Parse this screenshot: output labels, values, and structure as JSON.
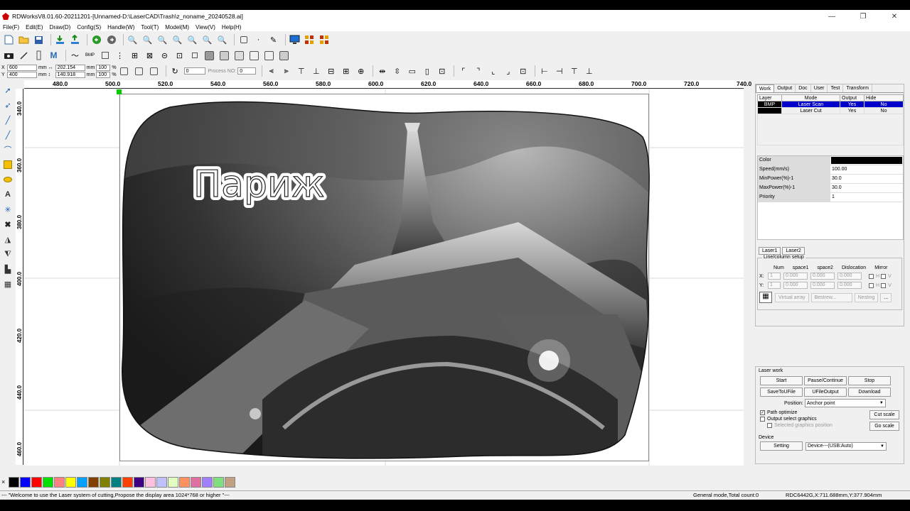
{
  "window": {
    "title": "RDWorksV8.01.60-20211201-[Unnamed-D:\\LaserCAD\\Trash\\z_noname_20240528.ai]",
    "controls": [
      "—",
      "❐",
      "✕"
    ]
  },
  "menu": [
    "File(F)",
    "Edit(E)",
    "Draw(D)",
    "Config(S)",
    "Handle(W)",
    "Tool(T)",
    "Model(M)",
    "View(V)",
    "Help(H)"
  ],
  "coords": {
    "x_label": "X",
    "x_value": "600",
    "y_label": "Y",
    "y_value": "400",
    "unit": "mm",
    "w_value": "202.154",
    "h_value": "140.918",
    "w_pct": "100",
    "h_pct": "100",
    "pct": "%",
    "rotate_value": "0",
    "process_no_label": "Process NO:",
    "process_no_value": "0"
  },
  "ruler": {
    "h": [
      "480.0",
      "500.0",
      "520.0",
      "540.0",
      "560.0",
      "580.0",
      "600.0",
      "620.0",
      "640.0",
      "660.0",
      "680.0",
      "700.0",
      "720.0",
      "740.0"
    ],
    "v": [
      "340.0",
      "360.0",
      "380.0",
      "400.0",
      "420.0",
      "440.0",
      "460.0"
    ]
  },
  "canvas": {
    "overlay_text": "Париж"
  },
  "panel": {
    "tabs": [
      "Work",
      "Output",
      "Doc",
      "User",
      "Test",
      "Transform"
    ],
    "layer_headers": [
      "Layer",
      "Mode",
      "Output",
      "Hide"
    ],
    "layers": [
      {
        "layer": "BMP",
        "mode": "Laser Scan",
        "output": "Yes",
        "hide": "No"
      },
      {
        "layer": "",
        "mode": "Laser Cut",
        "output": "Yes",
        "hide": "No"
      }
    ],
    "props": [
      {
        "k": "Color",
        "v": ""
      },
      {
        "k": "Speed(mm/s)",
        "v": "100.00"
      },
      {
        "k": "MinPower(%)-1",
        "v": "30.0"
      },
      {
        "k": "MaxPower(%)-1",
        "v": "30.0"
      },
      {
        "k": "Priority",
        "v": "1"
      }
    ],
    "laser_tabs": [
      "Laser1",
      "Laser2"
    ],
    "linecol": {
      "title": "Line/column setup",
      "headers": [
        "Num",
        "space1",
        "space2",
        "Dislocation",
        "Mirror"
      ],
      "x_label": "X:",
      "y_label": "Y:",
      "x_vals": [
        "1",
        "0.000",
        "0.000",
        "0.000"
      ],
      "y_vals": [
        "1",
        "0.000",
        "0.000",
        "0.000"
      ],
      "mirror_h": "H",
      "mirror_v": "V",
      "buttons": [
        "Virtual array",
        "Bestrew...",
        "Nesting",
        "..."
      ]
    }
  },
  "laser_work": {
    "title": "Laser work",
    "btns1": [
      "Start",
      "Pause/Continue",
      "Stop"
    ],
    "btns2": [
      "SaveToUFile",
      "UFileOutput",
      "Download"
    ],
    "position_label": "Position:",
    "position_value": "Anchor point",
    "path_optimize": "Path optimize",
    "output_select": "Output select graphics",
    "selected_pos": "Selected graphics position",
    "cut_scale": "Cut scale",
    "go_scale": "Go scale",
    "device_title": "Device",
    "setting": "Setting",
    "device_value": "Device---(USB:Auto)"
  },
  "palette": [
    "#000000",
    "#0000ff",
    "#ff0000",
    "#00e000",
    "#ff8080",
    "#ffff00",
    "#00a0ff",
    "#804000",
    "#808000",
    "#008080",
    "#ff4000",
    "#400080",
    "#ffc0e0",
    "#c0c0ff",
    "#e0ffc0",
    "#ff9060",
    "#e070a0",
    "#a080ff",
    "#80e080",
    "#c0a080"
  ],
  "status": {
    "left": "--- \"Welcome to use the Laser system of cutting,Propose the display area 1024*768 or higher \"---",
    "mode": "General mode,Total count:0",
    "pos": "RDC6442G,X:711.688mm,Y:377.904mm"
  }
}
